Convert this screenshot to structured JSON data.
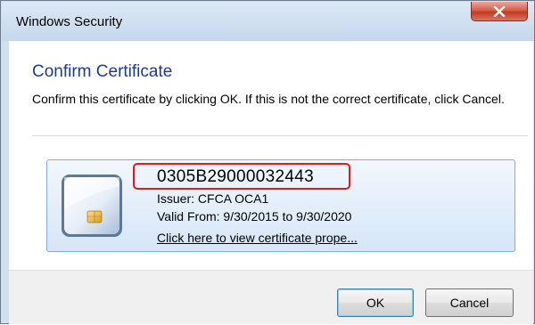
{
  "window": {
    "title": "Windows Security",
    "close_icon": "close-icon",
    "colors": {
      "close_button": "#c94530",
      "heading": "#1e3b8c",
      "highlight": "#e11a1a"
    }
  },
  "dialog": {
    "heading": "Confirm Certificate",
    "description": "Confirm this certificate by clicking OK. If this is not the correct certificate, click Cancel."
  },
  "certificate": {
    "icon": "smart-card-icon",
    "serial": "0305B29000032443",
    "issuer": "Issuer: CFCA OCA1",
    "valid": "Valid From: 9/30/2015 to 9/30/2020",
    "link": "Click here to view certificate prope..."
  },
  "buttons": {
    "ok": "OK",
    "cancel": "Cancel"
  }
}
